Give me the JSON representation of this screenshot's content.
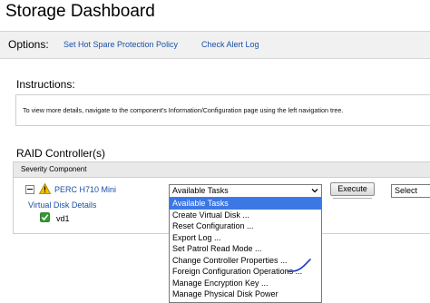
{
  "page": {
    "title": "Storage Dashboard"
  },
  "options": {
    "label": "Options:",
    "links": [
      "Set Hot Spare Protection Policy",
      "Check Alert Log"
    ]
  },
  "instructions": {
    "heading": "Instructions:",
    "text": "To view more details, navigate to the component's Information/Configuration page using the left navigation tree."
  },
  "raid": {
    "heading": "RAID Controller(s)",
    "table_header": "Severity Component",
    "controller_name": "PERC H710 Mini",
    "virtual_disk_link": "Virtual Disk Details",
    "virtual_disk_name": "vd1",
    "tasks_select_value": "Available Tasks",
    "execute_label": "Execute",
    "right_select_value": "Select"
  },
  "tasks_dropdown": {
    "highlighted_index": 0,
    "items": [
      "Available Tasks",
      "Create Virtual Disk ...",
      "Reset Configuration ...",
      "Export Log ...",
      "Set Patrol Read Mode ...",
      "Change Controller Properties ...",
      "Foreign Configuration Operations ...",
      "Manage Encryption Key ...",
      "Manage Physical Disk Power"
    ]
  },
  "icons": {
    "warning": "warning-triangle-icon",
    "ok": "ok-check-icon",
    "collapse": "collapse-minus-icon",
    "dropdown_arrow": "chevron-down-icon"
  },
  "colors": {
    "link": "#1a50a8",
    "highlight": "#3c77e3",
    "warning": "#f2c200",
    "ok": "#2f9a2f"
  }
}
